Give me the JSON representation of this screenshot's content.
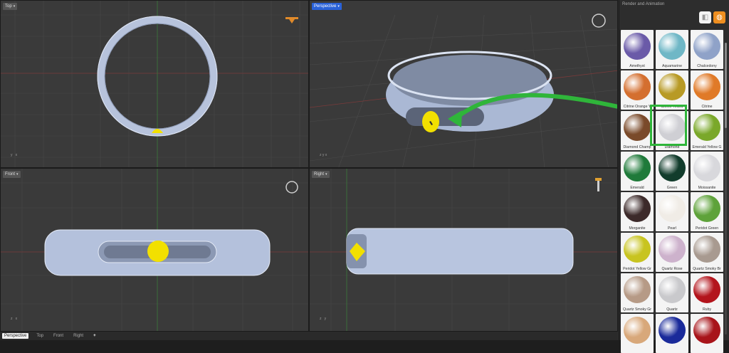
{
  "viewports": {
    "top": {
      "title": "Top"
    },
    "perspective": {
      "title": "Perspective"
    },
    "front": {
      "title": "Front"
    },
    "right": {
      "title": "Right"
    }
  },
  "axis_labels": {
    "x": "x",
    "y": "y",
    "z": "z"
  },
  "bottom_tabs": [
    "Perspective",
    "Top",
    "Front",
    "Right",
    "+"
  ],
  "panel": {
    "title": "Render and Animation"
  },
  "materials": [
    {
      "label": "Amethyst",
      "color": "#6a5aa8"
    },
    {
      "label": "Aquamarine",
      "color": "#6fb7c6"
    },
    {
      "label": "Chalcedony",
      "color": "#8fa2c8"
    },
    {
      "label": "Citrine Orange Y",
      "color": "#d46f2f"
    },
    {
      "label": "Citrine Yellow",
      "color": "#b89a25"
    },
    {
      "label": "Citrine",
      "color": "#e07a28"
    },
    {
      "label": "Diamond Champ",
      "color": "#7a4a2a"
    },
    {
      "label": "Diamond",
      "color": "#cfcfd4"
    },
    {
      "label": "Emerald Yellow G",
      "color": "#7aa82a"
    },
    {
      "label": "Emerald",
      "color": "#1f7a3a"
    },
    {
      "label": "Green",
      "color": "#123c2c"
    },
    {
      "label": "Moissanite",
      "color": "#d8d8dc"
    },
    {
      "label": "Morganite",
      "color": "#3c2a2a"
    },
    {
      "label": "Pearl",
      "color": "#f0ece6"
    },
    {
      "label": "Peridot Green",
      "color": "#5ea23a"
    },
    {
      "label": "Peridot Yellow Gr",
      "color": "#c8c420"
    },
    {
      "label": "Quartz Rose",
      "color": "#cdb2cc"
    },
    {
      "label": "Quartz Smoky Br",
      "color": "#a89a90"
    },
    {
      "label": "Quartz Smoky Gr",
      "color": "#b69a86"
    },
    {
      "label": "Quartz",
      "color": "#c9c9cc"
    },
    {
      "label": "Ruby",
      "color": "#b3141c"
    },
    {
      "label": "",
      "color": "#d8a87a"
    },
    {
      "label": "",
      "color": "#1a2a9a"
    },
    {
      "label": "",
      "color": "#a8141a"
    }
  ],
  "colors": {
    "highlight": "#2fb53a",
    "gem": "#f2e000",
    "active_tab": "#2a62d8"
  }
}
